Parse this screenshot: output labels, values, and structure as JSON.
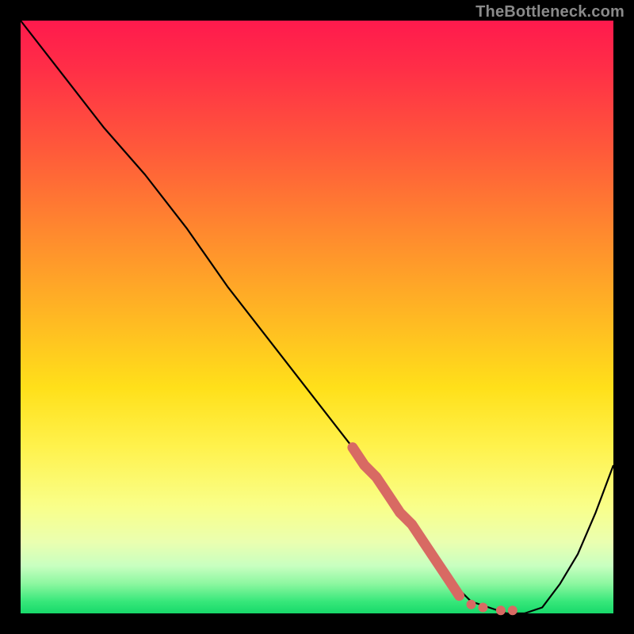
{
  "watermark": "TheBottleneck.com",
  "chart_data": {
    "type": "line",
    "title": "",
    "xlabel": "",
    "ylabel": "",
    "xlim": [
      0,
      100
    ],
    "ylim": [
      0,
      100
    ],
    "grid": false,
    "series": [
      {
        "name": "bottleneck-curve",
        "color": "#000000",
        "x": [
          0,
          7,
          14,
          21,
          28,
          35,
          42,
          49,
          56,
          63,
          67,
          70,
          73,
          76,
          79,
          82,
          85,
          88,
          91,
          94,
          97,
          100
        ],
        "y": [
          100,
          91,
          82,
          74,
          65,
          55,
          46,
          37,
          28,
          19,
          13,
          9,
          5,
          2,
          1,
          0,
          0,
          1,
          5,
          10,
          17,
          25
        ]
      }
    ],
    "highlight": {
      "name": "highlight-segment",
      "color": "#d86a63",
      "x": [
        56,
        58,
        60,
        62,
        64,
        66,
        68,
        70,
        72,
        74
      ],
      "y": [
        28,
        25,
        23,
        20,
        17,
        15,
        12,
        9,
        6,
        3
      ]
    },
    "dots": {
      "name": "highlight-dots",
      "color": "#d86a63",
      "points": [
        {
          "x": 76,
          "y": 1.5
        },
        {
          "x": 78,
          "y": 1
        },
        {
          "x": 81,
          "y": 0.5
        },
        {
          "x": 83,
          "y": 0.5
        }
      ]
    }
  }
}
